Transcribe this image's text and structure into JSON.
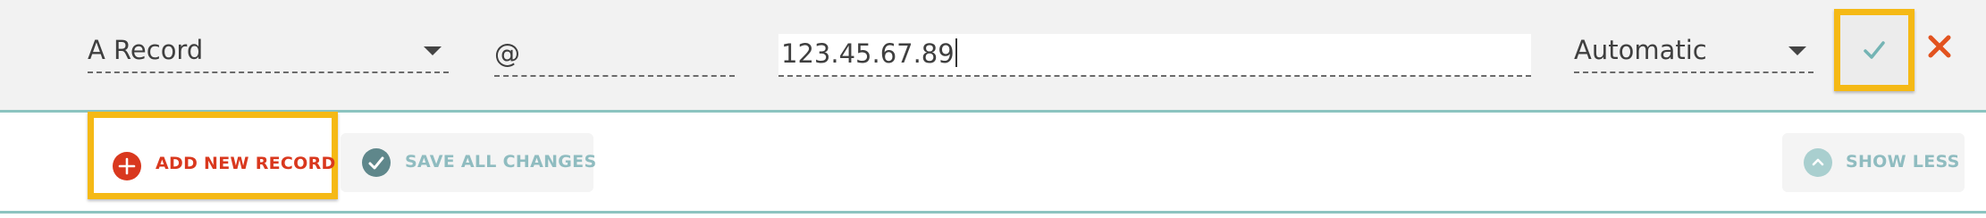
{
  "record_row": {
    "type_select": {
      "value": "A Record"
    },
    "host_input": {
      "value": "@"
    },
    "value_input": {
      "value": "123.45.67.89"
    },
    "ttl_select": {
      "value": "Automatic"
    },
    "icons": {
      "confirm": "checkmark-icon",
      "cancel": "close-x-icon"
    }
  },
  "actions": {
    "add_new_record": "ADD NEW RECORD",
    "save_all_changes": "SAVE ALL CHANGES",
    "show_less": "SHOW LESS",
    "icons": {
      "add": "plus-circle-icon",
      "save": "check-circle-icon",
      "show_less": "chevron-up-circle-icon"
    }
  },
  "colors": {
    "row_background": "#f2f2f2",
    "accent_teal": "#8cc4c0",
    "highlight_yellow": "#f5b915",
    "danger_red": "#d9381e",
    "muted_teal_text": "#8fbcc0"
  }
}
